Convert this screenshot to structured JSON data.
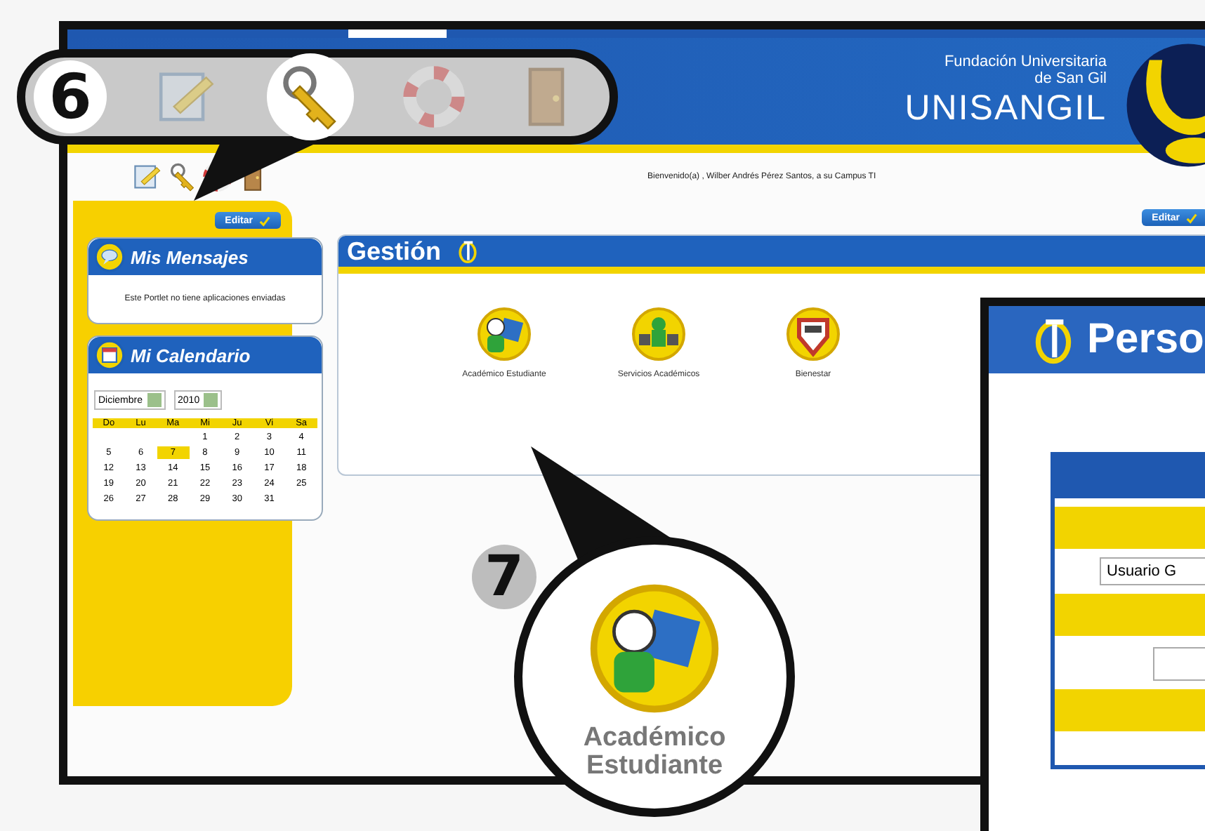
{
  "header": {
    "org_line_1": "Fundación Universitaria",
    "org_line_2": "de San Gil",
    "brand": "UNISANGIL"
  },
  "welcome": "Bienvenido(a) , Wilber Andrés Pérez Santos, a su Campus TI",
  "sidebar": {
    "edit_button": "Editar",
    "messages": {
      "title": "Mis Mensajes",
      "body": "Este Portlet no tiene aplicaciones enviadas"
    },
    "calendar": {
      "title": "Mi Calendario",
      "month": "Diciembre",
      "year": "2010",
      "weekdays": [
        "Do",
        "Lu",
        "Ma",
        "Mi",
        "Ju",
        "Vi",
        "Sa"
      ],
      "weeks": [
        [
          {
            "day": "1",
            "selected": false
          },
          {
            "day": "2",
            "selected": false
          },
          {
            "day": "3",
            "selected": false
          },
          {
            "day": "4",
            "selected": false
          }
        ],
        [
          {
            "day": "5",
            "selected": false
          },
          {
            "day": "6",
            "selected": false
          },
          {
            "day": "7",
            "selected": true
          },
          {
            "day": "8",
            "selected": false
          },
          {
            "day": "9",
            "selected": false
          },
          {
            "day": "10",
            "selected": false
          },
          {
            "day": "11",
            "selected": false
          }
        ],
        [
          {
            "day": "12",
            "selected": false
          },
          {
            "day": "13",
            "selected": false
          },
          {
            "day": "14",
            "selected": false
          },
          {
            "day": "15",
            "selected": false
          },
          {
            "day": "16",
            "selected": false
          },
          {
            "day": "17",
            "selected": false
          },
          {
            "day": "18",
            "selected": false
          }
        ],
        [
          {
            "day": "19",
            "selected": false
          },
          {
            "day": "20",
            "selected": false
          },
          {
            "day": "21",
            "selected": false
          },
          {
            "day": "22",
            "selected": false
          },
          {
            "day": "23",
            "selected": false
          },
          {
            "day": "24",
            "selected": false
          },
          {
            "day": "25",
            "selected": false
          }
        ],
        [
          {
            "day": "26",
            "selected": false
          },
          {
            "day": "27",
            "selected": false
          },
          {
            "day": "28",
            "selected": false
          },
          {
            "day": "29",
            "selected": false
          },
          {
            "day": "30",
            "selected": false
          },
          {
            "day": "31",
            "selected": false
          }
        ]
      ]
    }
  },
  "gestion": {
    "title": "Gestión",
    "edit_button": "Editar",
    "items": [
      {
        "kind": "student",
        "label": "Académico Estudiante"
      },
      {
        "kind": "services",
        "label": "Servicios Académicos"
      },
      {
        "kind": "wellbeing",
        "label": "Bienestar"
      }
    ]
  },
  "inset_window": {
    "title": "Perso",
    "field_value": "Usuario G"
  },
  "callout_toolbar": {
    "number": "6"
  },
  "callout_icon": {
    "number": "7",
    "label": "Académico Estudiante"
  }
}
